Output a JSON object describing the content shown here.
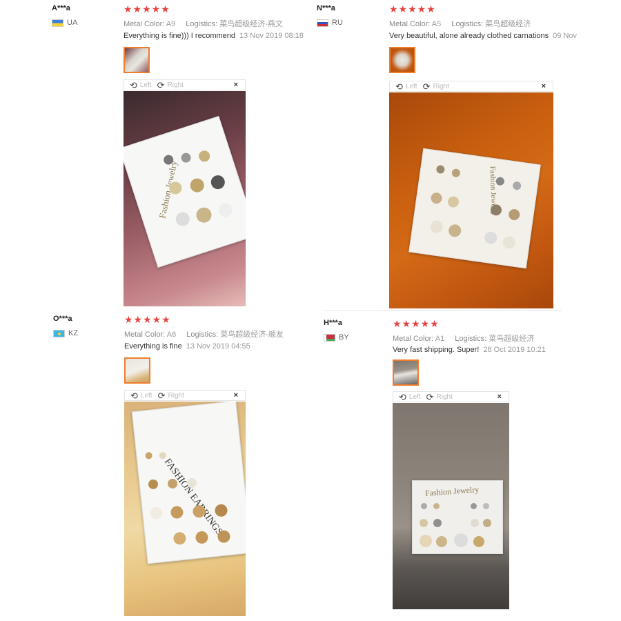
{
  "reviews": [
    {
      "user": "A***a",
      "country": "UA",
      "stars": "★★★★★",
      "metal_label": "Metal Color:",
      "metal_value": "A9",
      "logistics_label": "Logistics:",
      "logistics_value": "菜鸟超级经济-燕文",
      "text": "Everything is fine))) I recommend",
      "date": "13 Nov 2019 08:18",
      "left_label": "Left",
      "right_label": "Right",
      "close_label": "×",
      "card_text": "Fashion Jewelry"
    },
    {
      "user": "N***a",
      "country": "RU",
      "stars": "★★★★★",
      "metal_label": "Metal Color:",
      "metal_value": "A5",
      "logistics_label": "Logistics:",
      "logistics_value": "菜鸟超级经济",
      "text": "Very beautiful, alone already clothed carnations",
      "date": "09 Nov",
      "left_label": "Left",
      "right_label": "Right",
      "close_label": "×",
      "card_text": "Fashion Jewelry"
    },
    {
      "user": "O***a",
      "country": "KZ",
      "stars": "★★★★★",
      "metal_label": "Metal Color:",
      "metal_value": "A6",
      "logistics_label": "Logistics:",
      "logistics_value": "菜鸟超级经济-顺友",
      "text": "Everything is fine",
      "date": "13 Nov 2019 04:55",
      "left_label": "Left",
      "right_label": "Right",
      "close_label": "×",
      "card_text": "FASHION EARRINGS"
    },
    {
      "user": "H***a",
      "country": "BY",
      "stars": "★★★★★",
      "metal_label": "Metal Color:",
      "metal_value": "A1",
      "logistics_label": "Logistics:",
      "logistics_value": "菜鸟超级经济",
      "text": "Very fast shipping. Super!",
      "date": "28 Oct 2019 10:21",
      "left_label": "Left",
      "right_label": "Right",
      "close_label": "×",
      "card_text": "Fashion Jewelry"
    }
  ],
  "colors": {
    "star": "#e5433f",
    "thumb_border": "#f07c2c"
  }
}
